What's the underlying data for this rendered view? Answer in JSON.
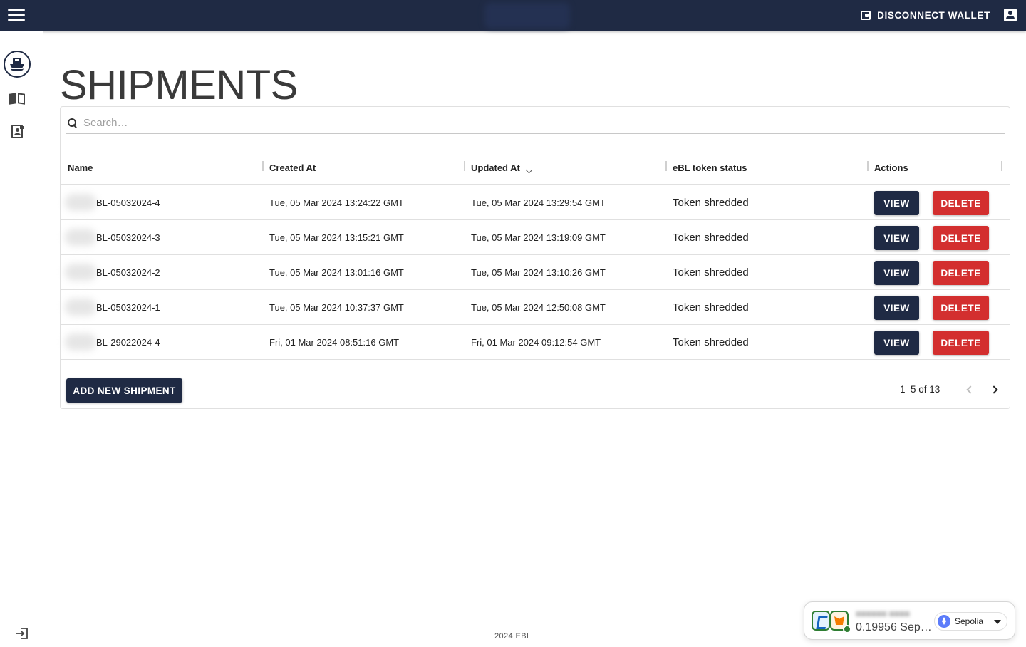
{
  "topbar": {
    "disconnect_label": "DISCONNECT WALLET"
  },
  "sidebar": {
    "items": [
      {
        "icon": "ship-icon",
        "active": true
      },
      {
        "icon": "book-icon",
        "active": false
      },
      {
        "icon": "badge-icon",
        "active": false
      }
    ],
    "bottom_icon": "exit-icon"
  },
  "page": {
    "title": "SHIPMENTS"
  },
  "search": {
    "placeholder": "Search…",
    "value": ""
  },
  "table": {
    "columns": [
      "Name",
      "Created At",
      "Updated At",
      "eBL token status",
      "Actions"
    ],
    "sort": {
      "column": "Updated At",
      "direction": "desc"
    },
    "rows": [
      {
        "name": "BL-05032024-4",
        "created": "Tue, 05 Mar 2024 13:24:22 GMT",
        "updated": "Tue, 05 Mar 2024 13:29:54 GMT",
        "status": "Token shredded"
      },
      {
        "name": "BL-05032024-3",
        "created": "Tue, 05 Mar 2024 13:15:21 GMT",
        "updated": "Tue, 05 Mar 2024 13:19:09 GMT",
        "status": "Token shredded"
      },
      {
        "name": "BL-05032024-2",
        "created": "Tue, 05 Mar 2024 13:01:16 GMT",
        "updated": "Tue, 05 Mar 2024 13:10:26 GMT",
        "status": "Token shredded"
      },
      {
        "name": "BL-05032024-1",
        "created": "Tue, 05 Mar 2024 10:37:37 GMT",
        "updated": "Tue, 05 Mar 2024 12:50:08 GMT",
        "status": "Token shredded"
      },
      {
        "name": "BL-29022024-4",
        "created": "Fri, 01 Mar 2024 08:51:16 GMT",
        "updated": "Fri, 01 Mar 2024 09:12:54 GMT",
        "status": "Token shredded"
      }
    ],
    "view_label": "VIEW",
    "delete_label": "DELETE"
  },
  "footer": {
    "add_label": "ADD NEW SHIPMENT",
    "pagination": "1–5 of 13",
    "copyright": "2024 EBL"
  },
  "wallet": {
    "balance": "0.19956 Sep…",
    "network": "Sepolia"
  },
  "colors": {
    "primary": "#1f2a44",
    "danger": "#d32f2f",
    "connected": "#2e7d32"
  }
}
